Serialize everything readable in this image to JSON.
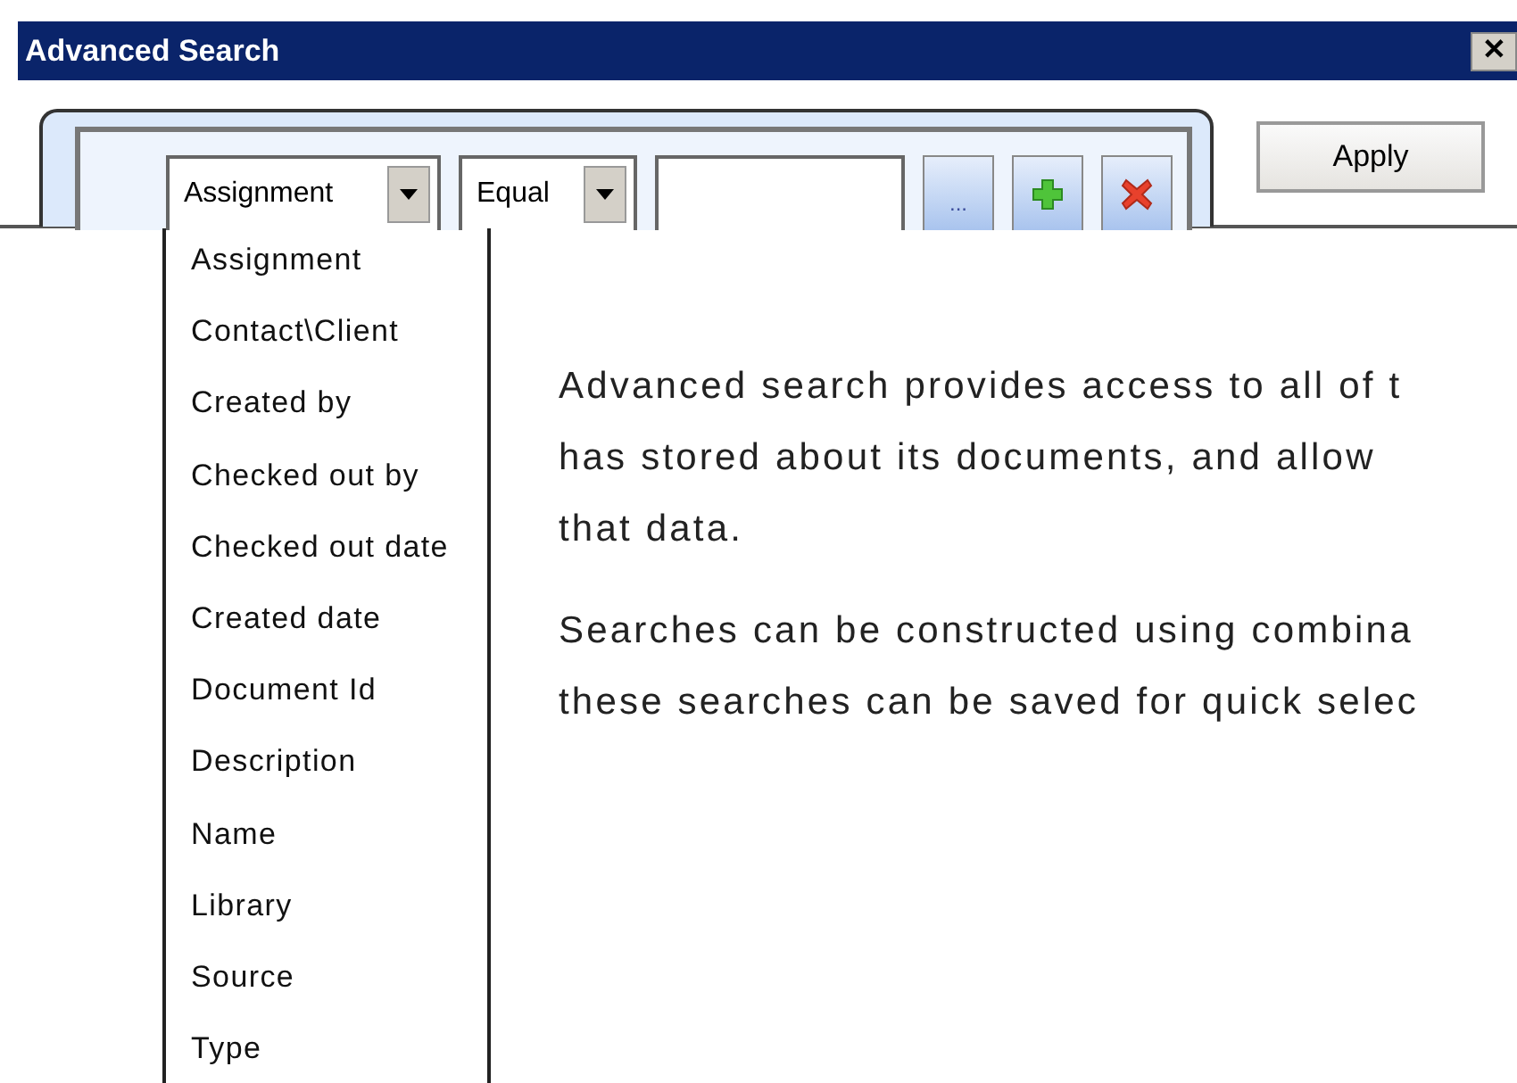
{
  "window": {
    "title": "Advanced Search",
    "close": "✕"
  },
  "filter": {
    "field": "Assignment",
    "operator": "Equal",
    "browse": "...",
    "apply": "Apply"
  },
  "dropdown": {
    "items": [
      "Assignment",
      "Contact\\Client",
      "Created by",
      "Checked out by",
      "Checked out date",
      "Created date",
      "Document Id",
      "Description",
      "Name",
      "Library",
      "Source",
      "Type"
    ]
  },
  "help": {
    "paragraphs": [
      [
        "Advanced search provides access to all of t",
        "has stored about its documents, and allow",
        "that data."
      ],
      [
        "Searches can be constructed using combina",
        "these searches can be saved for quick selec"
      ]
    ]
  }
}
